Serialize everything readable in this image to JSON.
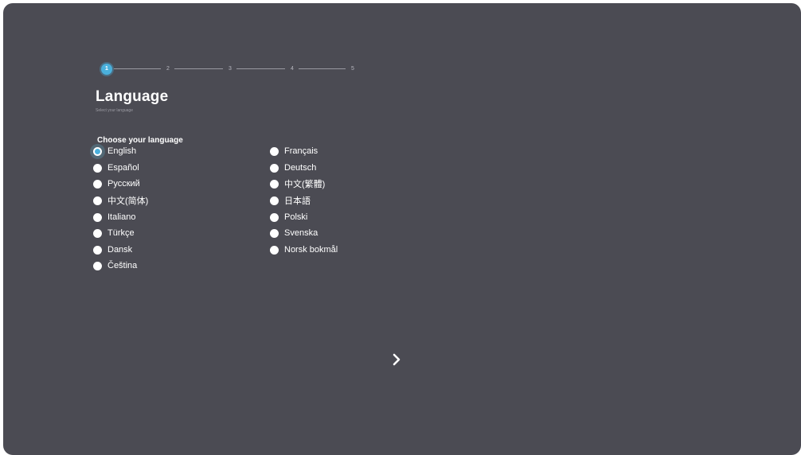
{
  "stepper": {
    "steps": [
      "1",
      "2",
      "3",
      "4",
      "5"
    ],
    "current": 1,
    "accent": "#4ab0dc"
  },
  "page": {
    "title": "Language",
    "subtitle": "Select your language",
    "section_label": "Choose your language"
  },
  "languages": {
    "left": [
      "English",
      "Español",
      "Русский",
      "中文(简体)",
      "Italiano",
      "Türkçe",
      "Dansk",
      "Čeština"
    ],
    "right": [
      "Français",
      "Deutsch",
      "中文(繁體)",
      "日本語",
      "Polski",
      "Svenska",
      "Norsk bokmål"
    ],
    "selected": "English"
  },
  "navigation": {
    "next_icon": "chevron-right-icon"
  },
  "colors": {
    "background": "#4b4b53",
    "accent": "#4ab0dc"
  }
}
